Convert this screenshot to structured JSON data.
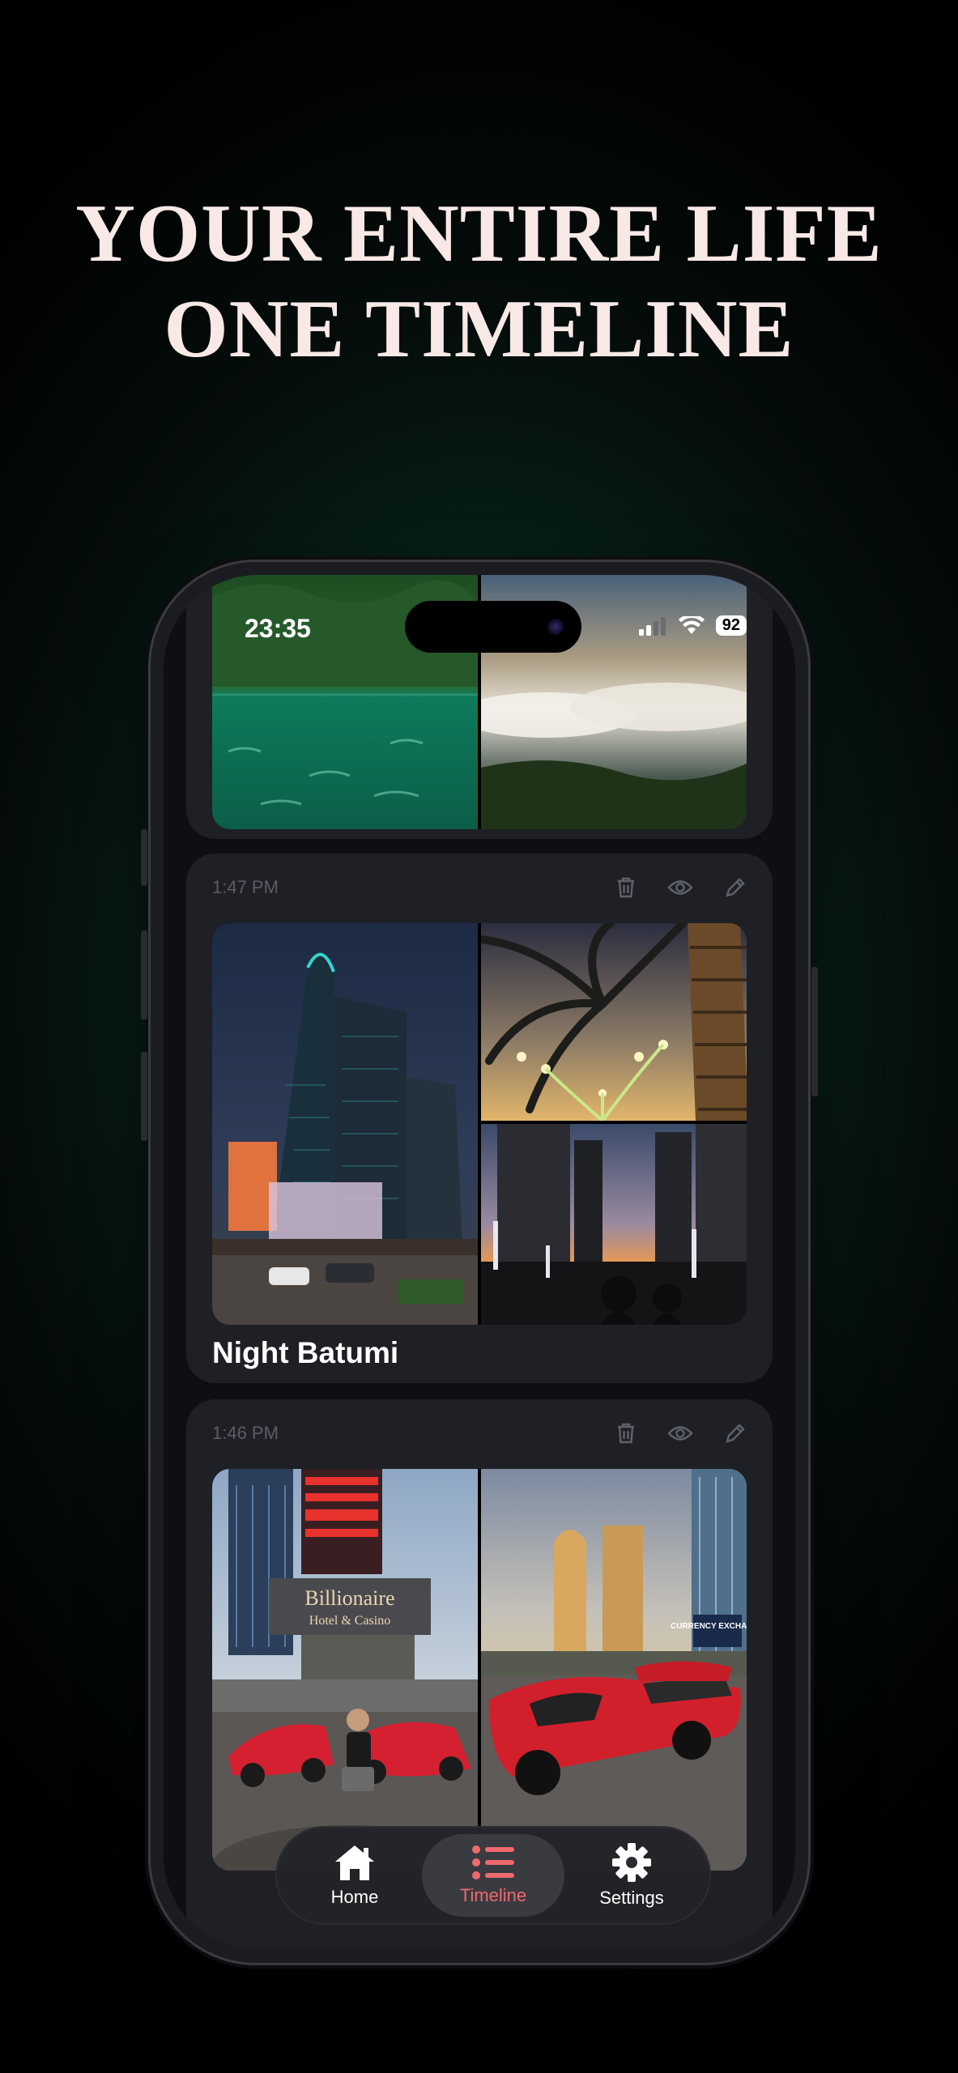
{
  "headline": {
    "line1": "YOUR ENTIRE LIFE",
    "line2": "ONE TIMELINE"
  },
  "status_bar": {
    "time": "23:35",
    "battery": "92"
  },
  "cards": [
    {
      "time": "",
      "title": "",
      "photos": [
        "green-sea-photo",
        "clouds-sunset-photo"
      ]
    },
    {
      "time": "1:47 PM",
      "title": "Night Batumi",
      "photos": [
        "tower-night-photo",
        "palm-lights-photo",
        "city-sunset-photo"
      ]
    },
    {
      "time": "1:46 PM",
      "title": "",
      "photos": [
        "billionaire-hotel-photo",
        "supercars-photo"
      ],
      "photo_text": {
        "hotel_sign": "Billionaire",
        "hotel_sub": "Hotel & Casino",
        "currency_sign": "CURRENCY EXCHANGE"
      }
    }
  ],
  "tabbar": {
    "items": [
      {
        "label": "Home",
        "icon": "home-icon"
      },
      {
        "label": "Timeline",
        "icon": "list-icon",
        "active": true
      },
      {
        "label": "Settings",
        "icon": "gear-icon"
      }
    ]
  },
  "colors": {
    "accent": "#ee6a6f",
    "headline": "#f8e9e6",
    "card": "#1e2025"
  }
}
